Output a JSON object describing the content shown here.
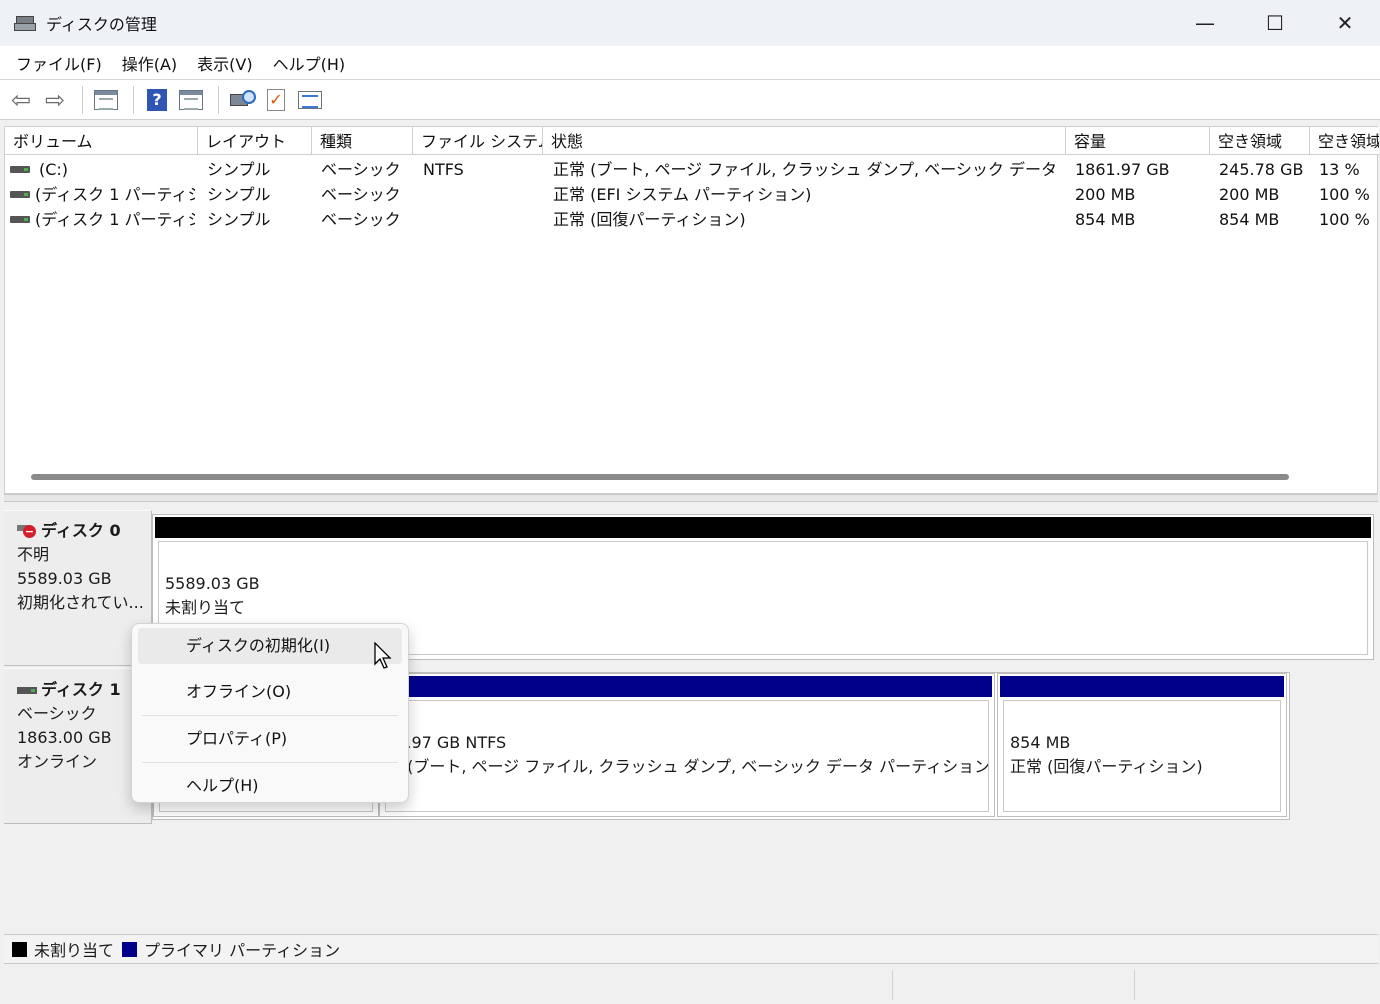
{
  "window": {
    "title": "ディスクの管理",
    "minimize": "—",
    "maximize": "☐",
    "close": "✕"
  },
  "menu": [
    "ファイル(F)",
    "操作(A)",
    "表示(V)",
    "ヘルプ(H)"
  ],
  "toolbar": {
    "icons": [
      "back-arrow-icon",
      "forward-arrow-icon",
      "show-hide-console-tree-icon",
      "help-icon",
      "show-hide-action-pane-icon",
      "rescan-disks-icon",
      "properties-check-icon",
      "settings-list-icon"
    ],
    "back": "⇦",
    "forward": "⇨",
    "help": "?",
    "check": "✓"
  },
  "volume_table": {
    "columns": [
      "ボリューム",
      "レイアウト",
      "種類",
      "ファイル システム",
      "状態",
      "容量",
      "空き領域",
      "空き領域"
    ],
    "rows": [
      [
        "(C:)",
        "シンプル",
        "ベーシック",
        "NTFS",
        "正常 (ブート, ページ ファイル, クラッシュ ダンプ, ベーシック データ パーティション)",
        "1861.97 GB",
        "245.78 GB",
        "13 %"
      ],
      [
        "(ディスク 1 パーティショ...",
        "シンプル",
        "ベーシック",
        "",
        "正常 (EFI システム パーティション)",
        "200 MB",
        "200 MB",
        "100 %"
      ],
      [
        "(ディスク 1 パーティショ...",
        "シンプル",
        "ベーシック",
        "",
        "正常 (回復パーティション)",
        "854 MB",
        "854 MB",
        "100 %"
      ]
    ]
  },
  "disks": [
    {
      "name": "ディスク 0",
      "type": "不明",
      "size": "5589.03 GB",
      "status": "初期化されてい...",
      "partition": {
        "size": "5589.03 GB",
        "label": "未割り当て"
      }
    },
    {
      "name": "ディスク 1",
      "type": "ベーシック",
      "size": "1863.00 GB",
      "status": "オンライン",
      "partitions": [
        {
          "line1": "C:)",
          "line2": "61.97 GB NTFS",
          "line3": "常 (ブート, ページ ファイル, クラッシュ ダンプ, ベーシック データ パーティション)"
        },
        {
          "line1": "854 MB",
          "line2": "正常 (回復パーティション)"
        }
      ]
    }
  ],
  "context_menu": [
    "ディスクの初期化(I)",
    "オフライン(O)",
    "プロパティ(P)",
    "ヘルプ(H)"
  ],
  "legend": [
    "未割り当て",
    "プライマリ パーティション"
  ],
  "colors": {
    "unallocated": "#000000",
    "primary": "#00008b"
  }
}
